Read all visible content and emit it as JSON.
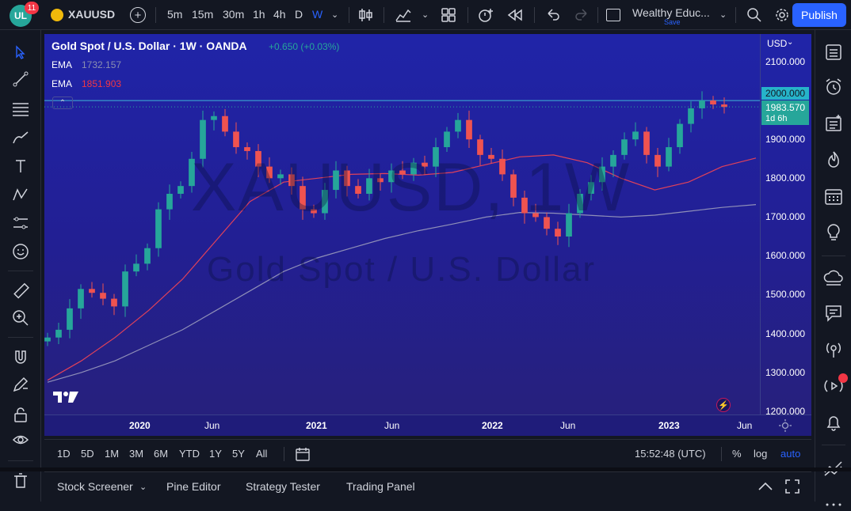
{
  "topbar": {
    "avatar_text": "UL",
    "notification_count": "11",
    "symbol": "XAUUSD",
    "timeframes": [
      "5m",
      "15m",
      "30m",
      "1h",
      "4h",
      "D",
      "W"
    ],
    "active_timeframe": "W",
    "layout_name": "Wealthy Educ...",
    "layout_status": "Save",
    "publish_label": "Publish"
  },
  "chart": {
    "title": "Gold Spot / U.S. Dollar · 1W · OANDA",
    "change": "+0.650 (+0.03%)",
    "indicators": [
      {
        "label": "EMA",
        "value": "1732.157",
        "color": "#8a8fb0"
      },
      {
        "label": "EMA",
        "value": "1851.903",
        "color": "#f23645"
      }
    ],
    "collapse_glyph": "⌃",
    "watermark_symbol": "XAUUSD, 1W",
    "watermark_name": "Gold Spot / U.S. Dollar",
    "currency_label": "USD",
    "price_labels": [
      "2100.000",
      "1900.000",
      "1800.000",
      "1700.000",
      "1600.000",
      "1500.000",
      "1400.000",
      "1300.000",
      "1200.000"
    ],
    "line_price_label": "2000.000",
    "current_price_label": "1983.570",
    "countdown_label": "1d 6h",
    "time_labels": [
      "2020",
      "Jun",
      "2021",
      "Jun",
      "2022",
      "Jun",
      "2023",
      "Jun"
    ]
  },
  "chart_data": {
    "type": "candlestick",
    "ylim": [
      1200,
      2100
    ],
    "horizontal_line": 2000,
    "current_price": 1983.57,
    "ema_fast_series": [
      1280,
      1330,
      1390,
      1460,
      1540,
      1640,
      1740,
      1790,
      1800,
      1810,
      1812,
      1808,
      1815,
      1835,
      1855,
      1860,
      1840,
      1800,
      1770,
      1790,
      1830,
      1851.9
    ],
    "ema_slow_series": [
      1275,
      1300,
      1330,
      1370,
      1410,
      1460,
      1510,
      1560,
      1595,
      1620,
      1645,
      1665,
      1682,
      1700,
      1712,
      1710,
      1705,
      1700,
      1705,
      1715,
      1725,
      1732.2
    ],
    "closes": [
      1390,
      1410,
      1465,
      1515,
      1505,
      1490,
      1470,
      1560,
      1580,
      1620,
      1720,
      1760,
      1780,
      1850,
      1950,
      1960,
      1920,
      1880,
      1870,
      1830,
      1800,
      1810,
      1780,
      1720,
      1710,
      1770,
      1820,
      1780,
      1760,
      1800,
      1790,
      1820,
      1810,
      1840,
      1830,
      1880,
      1920,
      1950,
      1900,
      1860,
      1850,
      1810,
      1750,
      1710,
      1700,
      1670,
      1650,
      1710,
      1760,
      1790,
      1830,
      1860,
      1900,
      1920,
      1860,
      1830,
      1880,
      1940,
      1980,
      2000,
      1990,
      1983.57
    ]
  },
  "bottom": {
    "ranges": [
      "1D",
      "5D",
      "1M",
      "3M",
      "6M",
      "YTD",
      "1Y",
      "5Y",
      "All"
    ],
    "clock": "15:52:48 (UTC)",
    "percent_label": "%",
    "log_label": "log",
    "auto_label": "auto"
  },
  "tabs": [
    "Stock Screener",
    "Pine Editor",
    "Strategy Tester",
    "Trading Panel"
  ],
  "colors": {
    "up": "#26a69a",
    "down": "#ef5350",
    "accent": "#2962ff",
    "price_tag": "#26a69a",
    "line_tag": "#22ab94"
  }
}
